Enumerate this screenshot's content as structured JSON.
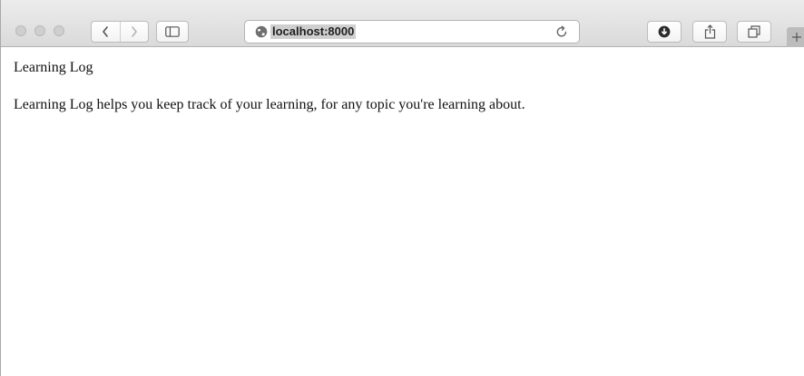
{
  "browser": {
    "url": "localhost:8000",
    "icons": [
      "close-button",
      "minimize-button",
      "maximize-button",
      "back-icon",
      "forward-icon",
      "sidebar-icon",
      "globe-icon",
      "reload-icon",
      "downloads-icon",
      "share-icon",
      "tabs-icon",
      "plus-icon"
    ],
    "accent_color": "#cfcfcf"
  },
  "page": {
    "title": "Learning Log",
    "description": "Learning Log helps you keep track of your learning, for any topic you're learning about."
  }
}
